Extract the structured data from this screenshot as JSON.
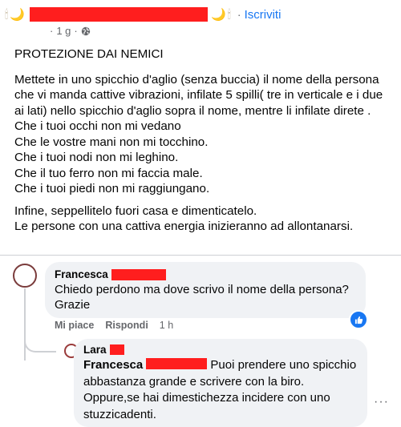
{
  "header": {
    "emoji_left": [
      "🕯",
      "🌙"
    ],
    "emoji_right": [
      "🌙",
      "🕯"
    ],
    "separator": "·",
    "subscribe_label": "Iscriviti",
    "time": "1 g",
    "meta_separator": "·"
  },
  "post": {
    "title": "PROTEZIONE DAI NEMICI",
    "body": "Mettete in uno spicchio d'aglio (senza buccia) il nome della persona che vi manda cattive vibrazioni,  infilate 5 spilli( tre in verticale e i due ai lati) nello spicchio d'aglio sopra il nome, mentre li infilate direte .\nChe i tuoi occhi non mi vedano\nChe le vostre mani non mi tocchino.\nChe i tuoi nodi non mi leghino.\nChe il tuo ferro non mi faccia male.\nChe i tuoi piedi non mi raggiungano.",
    "closing": "Infine, seppellitelo fuori casa e dimenticatelo.\nLe persone con una cattiva energia inizieranno ad allontanarsi."
  },
  "comment": {
    "author": "Francesca",
    "text": "Chiedo perdono ma dove scrivo il nome della persona?\nGrazie",
    "like_label": "Mi piace",
    "reply_label": "Rispondi",
    "time": "1 h"
  },
  "reply": {
    "author": "Lara",
    "mention": "Francesca",
    "text": "Puoi prendere uno spicchio abbastanza grande e scrivere con la biro. Oppure,se hai dimestichezza incidere con uno stuzzicadenti."
  },
  "more_options": "···",
  "colors": {
    "redaction": "#ff1e1e",
    "accent": "#1877f2",
    "muted": "#65676b",
    "bubble": "#f0f2f5"
  }
}
